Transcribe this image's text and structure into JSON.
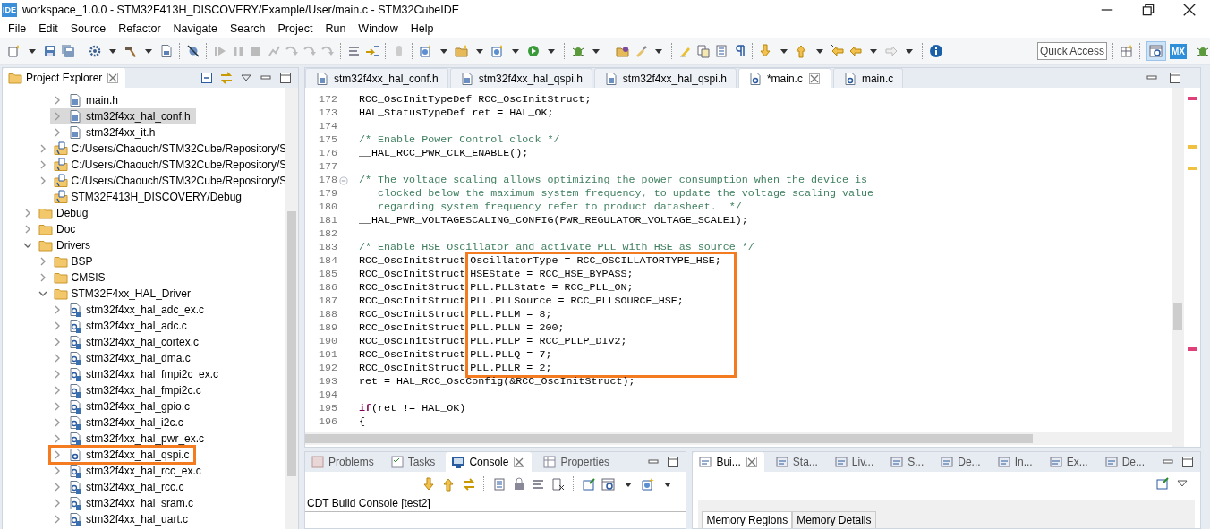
{
  "window": {
    "icon_label": "IDE",
    "title": "workspace_1.0.0 - STM32F413H_DISCOVERY/Example/User/main.c - STM32CubeIDE"
  },
  "menu": [
    "File",
    "Edit",
    "Source",
    "Refactor",
    "Navigate",
    "Search",
    "Project",
    "Run",
    "Window",
    "Help"
  ],
  "toolbar": {
    "quick_access": {
      "placeholder": "Quick Access"
    },
    "perspective_label": "MX"
  },
  "project_explorer": {
    "title": "Project Explorer",
    "tree": [
      {
        "children": [
          {
            "children": [
              {
                "label": "main.h",
                "kind": "header",
                "expanded": false,
                "selected": false
              },
              {
                "label": "stm32f4xx_hal_conf.h",
                "kind": "header",
                "expanded": false,
                "selected": true
              },
              {
                "label": "stm32f4xx_it.h",
                "kind": "header",
                "expanded": false,
                "selected": false
              }
            ]
          },
          {
            "label": "C:/Users/Chaouch/STM32Cube/Repository/S",
            "kind": "include_folder",
            "expanded": false,
            "selected": false
          },
          {
            "label": "C:/Users/Chaouch/STM32Cube/Repository/S",
            "kind": "include_folder",
            "expanded": false,
            "selected": false
          },
          {
            "label": "C:/Users/Chaouch/STM32Cube/Repository/S",
            "kind": "include_folder",
            "expanded": false,
            "selected": false
          },
          {
            "label": "STM32F413H_DISCOVERY/Debug",
            "kind": "include_folder",
            "selected": false
          }
        ]
      },
      {
        "label": "Debug",
        "kind": "folder",
        "expanded": false,
        "selected": false
      },
      {
        "label": "Doc",
        "kind": "folder",
        "expanded": false,
        "selected": false
      },
      {
        "label": "Drivers",
        "kind": "folder",
        "expanded": true,
        "selected": false,
        "children": [
          {
            "label": "BSP",
            "kind": "folder",
            "expanded": false,
            "selected": false
          },
          {
            "label": "CMSIS",
            "kind": "folder",
            "expanded": false,
            "selected": false
          },
          {
            "label": "STM32F4xx_HAL_Driver",
            "kind": "folder",
            "expanded": true,
            "selected": false,
            "children": [
              {
                "label": "stm32f4xx_hal_adc_ex.c",
                "kind": "c_source",
                "expanded": false,
                "selected": false,
                "highlighted": false
              },
              {
                "label": "stm32f4xx_hal_adc.c",
                "kind": "c_source",
                "expanded": false,
                "selected": false,
                "highlighted": false
              },
              {
                "label": "stm32f4xx_hal_cortex.c",
                "kind": "c_source",
                "expanded": false,
                "selected": false,
                "highlighted": false
              },
              {
                "label": "stm32f4xx_hal_dma.c",
                "kind": "c_source",
                "expanded": false,
                "selected": false,
                "highlighted": false
              },
              {
                "label": "stm32f4xx_hal_fmpi2c_ex.c",
                "kind": "c_source",
                "expanded": false,
                "selected": false,
                "highlighted": false
              },
              {
                "label": "stm32f4xx_hal_fmpi2c.c",
                "kind": "c_source",
                "expanded": false,
                "selected": false,
                "highlighted": false
              },
              {
                "label": "stm32f4xx_hal_gpio.c",
                "kind": "c_source",
                "expanded": false,
                "selected": false,
                "highlighted": false
              },
              {
                "label": "stm32f4xx_hal_i2c.c",
                "kind": "c_source",
                "expanded": false,
                "selected": false,
                "highlighted": false
              },
              {
                "label": "stm32f4xx_hal_pwr_ex.c",
                "kind": "c_source",
                "expanded": false,
                "selected": false,
                "highlighted": false
              },
              {
                "label": "stm32f4xx_hal_qspi.c",
                "kind": "c",
                "expanded": false,
                "selected": false,
                "highlighted": true
              },
              {
                "label": "stm32f4xx_hal_rcc_ex.c",
                "kind": "c_source",
                "expanded": false,
                "selected": false,
                "highlighted": false
              },
              {
                "label": "stm32f4xx_hal_rcc.c",
                "kind": "c_source",
                "expanded": false,
                "selected": false,
                "highlighted": false
              },
              {
                "label": "stm32f4xx_hal_sram.c",
                "kind": "c_source",
                "expanded": false,
                "selected": false,
                "highlighted": false
              },
              {
                "label": "stm32f4xx_hal_uart.c",
                "kind": "c_source",
                "expanded": false,
                "selected": false,
                "highlighted": false
              }
            ]
          }
        ]
      }
    ]
  },
  "editor": {
    "tabs": [
      {
        "label": "stm32f4xx_hal_conf.h",
        "kind": "header",
        "selected": false
      },
      {
        "label": "stm32f4xx_hal_qspi.h",
        "kind": "header",
        "selected": false
      },
      {
        "label": "stm32f4xx_hal_qspi.h",
        "kind": "header",
        "selected": false
      },
      {
        "label": "*main.c",
        "kind": "c",
        "selected": true
      },
      {
        "label": "main.c",
        "kind": "c",
        "selected": false
      }
    ],
    "lines_before": [
      {
        "num": "172",
        "kind": "code",
        "text": "RCC_OscInitTypeDef RCC_OscInitStruct;"
      },
      {
        "num": "173",
        "kind": "code",
        "text": "HAL_StatusTypeDef ret = HAL_OK;"
      },
      {
        "num": "174",
        "kind": "blank"
      },
      {
        "num": "175",
        "kind": "comment",
        "text": "/* Enable Power Control clock */"
      },
      {
        "num": "176",
        "kind": "code",
        "text": "__HAL_RCC_PWR_CLK_ENABLE();"
      },
      {
        "num": "177",
        "kind": "blank"
      },
      {
        "num": "178",
        "kind": "comment_start",
        "text": "/* The voltage scaling allows optimizing the power consumption when the device is"
      },
      {
        "num": "179",
        "kind": "comment",
        "text": "   clocked below the maximum system frequency, to update the voltage scaling value"
      },
      {
        "num": "180",
        "kind": "comment",
        "text": "   regarding system frequency refer to product datasheet.  */"
      },
      {
        "num": "181",
        "kind": "code",
        "text": "__HAL_PWR_VOLTAGESCALING_CONFIG(PWR_REGULATOR_VOLTAGE_SCALE1);"
      },
      {
        "num": "182",
        "kind": "blank"
      },
      {
        "num": "183",
        "kind": "comment",
        "text": "/* Enable HSE Oscillator and activate PLL with HSE as source */"
      }
    ],
    "boxed_lines": [
      {
        "num": "184",
        "prefix": "RCC_OscInitStruct",
        "text": "OscillatorType = RCC_OSCILLATORTYPE_HSE;"
      },
      {
        "num": "185",
        "prefix": "RCC_OscInitStruct",
        "text": "HSEState = RCC_HSE_BYPASS;"
      },
      {
        "num": "186",
        "prefix": "RCC_OscInitStruct",
        "text": "PLL.PLLState = RCC_PLL_ON;"
      },
      {
        "num": "187",
        "prefix": "RCC_OscInitStruct",
        "text": "PLL.PLLSource = RCC_PLLSOURCE_HSE;"
      },
      {
        "num": "188",
        "prefix": "RCC_OscInitStruct",
        "text": "PLL.PLLM = 8;"
      },
      {
        "num": "189",
        "prefix": "RCC_OscInitStruct",
        "text": "PLL.PLLN = 200;"
      },
      {
        "num": "190",
        "prefix": "RCC_OscInitStruct",
        "text": "PLL.PLLP = RCC_PLLP_DIV2;"
      },
      {
        "num": "191",
        "prefix": "RCC_OscInitStruct",
        "text": "PLL.PLLQ = 7;"
      },
      {
        "num": "192",
        "prefix": "RCC_OscInitStruct",
        "text": "PLL.PLLR = 2;"
      }
    ],
    "lines_after": [
      {
        "num": "193",
        "kind": "code",
        "text": "ret = HAL_RCC_OscConfig(&RCC_OscInitStruct);"
      },
      {
        "num": "194",
        "kind": "blank"
      },
      {
        "num": "195",
        "kind": "code",
        "text": "**if**(ret != HAL_OK)"
      },
      {
        "num": "196",
        "kind": "code",
        "text": "{"
      }
    ]
  },
  "console": {
    "tabs": [
      {
        "label": "Problems",
        "kind": "problems",
        "selected": false
      },
      {
        "label": "Tasks",
        "kind": "tasks",
        "selected": false
      },
      {
        "label": "Console",
        "kind": "console",
        "selected": true
      },
      {
        "label": "Properties",
        "kind": "properties",
        "selected": false
      }
    ],
    "label": "CDT Build Console [test2]"
  },
  "side_panel": {
    "tabs": [
      {
        "label": "Bui...",
        "selected": true
      },
      {
        "label": "Sta...",
        "selected": false
      },
      {
        "label": "Liv...",
        "selected": false
      },
      {
        "label": "S...",
        "selected": false
      },
      {
        "label": "De...",
        "selected": false
      },
      {
        "label": "In...",
        "selected": false
      },
      {
        "label": "Ex...",
        "selected": false
      },
      {
        "label": "De...",
        "selected": false
      }
    ],
    "inner_tabs": [
      {
        "label": "Memory Regions",
        "selected": true
      },
      {
        "label": "Memory Details",
        "selected": false
      }
    ]
  }
}
